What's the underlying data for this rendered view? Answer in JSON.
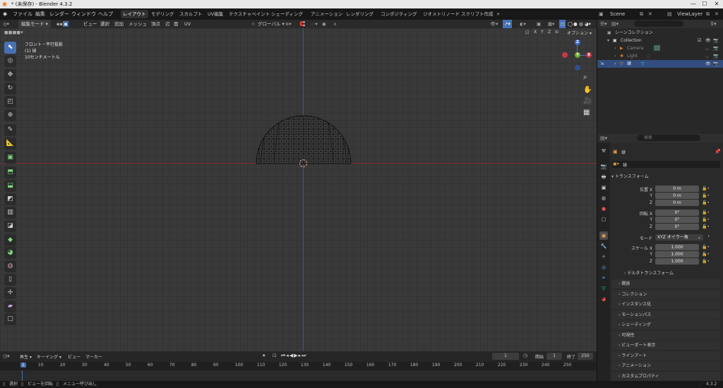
{
  "window": {
    "title": "* (未保存) - Blender 4.3.2"
  },
  "menu": {
    "file": "ファイル",
    "edit": "編集",
    "render": "レンダー",
    "window": "ウィンドウ",
    "help": "ヘルプ"
  },
  "workspaces": [
    "レイアウト",
    "モデリング",
    "スカルプト",
    "UV編集",
    "テクスチャペイント",
    "シェーディング",
    "アニメーション",
    "レンダリング",
    "コンポジティング",
    "ジオメトリノード",
    "スクリプト作成"
  ],
  "workspace_add": "+",
  "scene": {
    "name": "Scene",
    "view_layer": "ViewLayer"
  },
  "viewport_header": {
    "mode": "編集モード",
    "view": "ビュー",
    "select": "選択",
    "add": "追加",
    "mesh": "メッシュ",
    "vertex": "頂点",
    "edge": "辺",
    "face": "面",
    "uv": "UV",
    "orientation": "グローバル",
    "axes": [
      "X",
      "Y",
      "Z"
    ],
    "options": "オプション"
  },
  "viewport_overlay": {
    "view_name": "フロント・平行投影",
    "object": "(1) 球",
    "scale": "10センチメートル"
  },
  "gizmo": {
    "x": "X",
    "y": "Y",
    "z": "Z"
  },
  "outliner": {
    "search_placeholder": "",
    "scene_collection": "シーンコレクション",
    "items": [
      {
        "name": "Collection"
      },
      {
        "name": "Camera"
      },
      {
        "name": "Light"
      },
      {
        "name": "球"
      }
    ]
  },
  "properties": {
    "search_placeholder": "検索",
    "object_name": "球",
    "object_field": "球",
    "transform_title": "トランスフォーム",
    "location": {
      "label": "位置 X",
      "x": "0 m",
      "y": "0 m",
      "z": "0 m"
    },
    "rotation": {
      "label": "回転 X",
      "x": "0°",
      "y": "0°",
      "z": "0°"
    },
    "mode_label": "モード",
    "mode_value": "XYZ オイラー角",
    "scale": {
      "label": "スケール X",
      "x": "1.000",
      "y": "1.000",
      "z": "1.000"
    },
    "axis_y": "Y",
    "axis_z": "Z",
    "sections": [
      "デルタトランスフォーム",
      "関係",
      "コレクション",
      "インスタンス化",
      "モーションパス",
      "シェーディング",
      "可視性",
      "ビューポート表示",
      "ラインアート",
      "アニメーション",
      "カスタムプロパティ"
    ]
  },
  "timeline": {
    "playback": "再生",
    "keying": "キーイング",
    "view": "ビュー",
    "marker": "マーカー",
    "current_frame": "1",
    "start_label": "開始",
    "start": "1",
    "end_label": "終了",
    "end": "250",
    "ticks": [
      "1",
      "10",
      "20",
      "30",
      "40",
      "50",
      "60",
      "70",
      "80",
      "90",
      "100",
      "110",
      "120",
      "130",
      "140",
      "150",
      "160",
      "170",
      "180",
      "190",
      "200",
      "210",
      "220",
      "230",
      "240",
      "250"
    ]
  },
  "status": {
    "select": "選択",
    "rotate": "ビューを回転",
    "menu": "メニュー呼び出し",
    "version": "4.3.2"
  },
  "colors": {
    "accent": "#4772b3",
    "x_axis": "#8a2b3a",
    "y_axis": "#3a5c9a",
    "selected": "#334d80"
  }
}
